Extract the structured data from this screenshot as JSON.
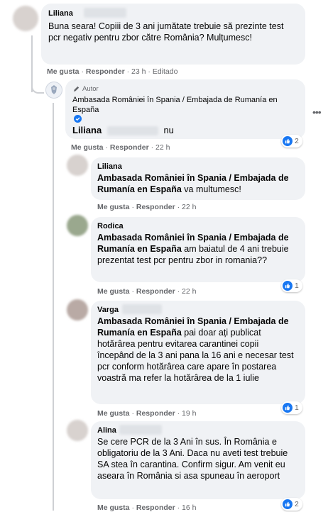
{
  "actions": {
    "like": "Me gusta",
    "reply": "Responder",
    "sep": "·",
    "edited": "Editado"
  },
  "comments": [
    {
      "author": "Liliana",
      "text": "Buna seara! Copiii de 3 ani jumătate trebuie să prezinte test pcr negativ pentru zbor către România? Mulțumesc!",
      "time": "23 h"
    },
    {
      "author_badge": "Autor",
      "author": "Ambasada României în Spania / Embajada de Rumanía en España",
      "mention": "Liliana",
      "text": "nu",
      "time": "22 h",
      "reactions": "2"
    },
    {
      "author": "Liliana",
      "mention": "Ambasada României în Spania / Embajada de Rumanía en España",
      "text": "va multumesc!",
      "time": "22 h"
    },
    {
      "author": "Rodica",
      "mention": "Ambasada României în Spania / Embajada de Rumanía en España",
      "text": "am baiatul de 4 ani trebuie prezentat test pcr pentru zbor in romania??",
      "time": "22 h",
      "reactions": "1"
    },
    {
      "author": "Varga",
      "mention": "Ambasada României în Spania / Embajada de Rumanía en España",
      "text": "pai doar ați publicat hotărârea pentru evitarea carantinei copii începând de la 3 ani pana la 16 ani e necesar test pcr conform hotărârea care apare în postarea voastră ma refer la hotărârea de la 1 iulie",
      "time": "19 h",
      "reactions": "1"
    },
    {
      "author": "Alina",
      "text": "Se cere PCR de la 3 Ani în sus. În România e obligatoriu de la 3 Ani. Daca nu aveti test trebuie SA stea în carantina. Confirm sigur. Am venit eu aseara în România si asa spuneau în aeroport",
      "time": "16 h",
      "reactions": "2"
    }
  ]
}
